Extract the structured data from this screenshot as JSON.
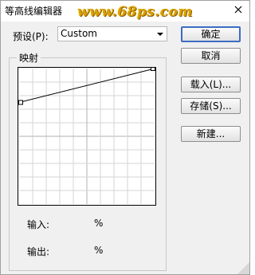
{
  "window": {
    "title": "等高线编辑器",
    "watermark": "www.68ps.com"
  },
  "preset": {
    "label": "预设(P):",
    "value": "Custom"
  },
  "buttons": {
    "ok": "确定",
    "cancel": "取消",
    "load": "载入(L)...",
    "save": "存储(S)...",
    "new": "新建..."
  },
  "mapping": {
    "label": "映射",
    "curve": {
      "points": [
        [
          0,
          0.75
        ],
        [
          1,
          1
        ]
      ]
    },
    "grid_divisions": 10,
    "input_label": "输入:",
    "input_unit": "%",
    "output_label": "输出:",
    "output_unit": "%"
  },
  "colors": {
    "default_button_border": "#3c6cc2",
    "watermark": "#d9a000"
  },
  "icons": {
    "close": "close-icon",
    "dropdown": "chevron-down-icon"
  }
}
